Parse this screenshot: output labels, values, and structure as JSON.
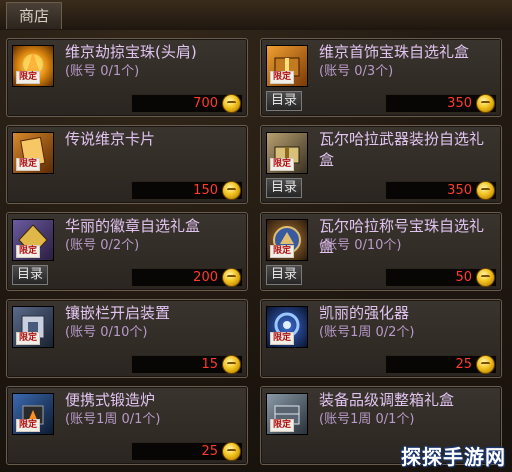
{
  "shop_tab": "商店",
  "badge_text": "限定",
  "dir_label": "目录",
  "currency": "coin-icon",
  "items": [
    {
      "name": "维京劫掠宝珠(头肩)",
      "limit": "(账号 0/1个)",
      "price": "700",
      "icon": "fire-orb-icon",
      "dir": false
    },
    {
      "name": "维京首饰宝珠自选礼盒",
      "limit": "(账号 0/3个)",
      "price": "350",
      "icon": "gift-box-icon",
      "dir": true
    },
    {
      "name": "传说维京卡片",
      "limit": "",
      "price": "150",
      "icon": "card-icon",
      "dir": false
    },
    {
      "name": "瓦尔哈拉武器装扮自选礼盒",
      "limit": "",
      "price": "350",
      "icon": "gift-box-icon",
      "dir": true
    },
    {
      "name": "华丽的徽章自选礼盒",
      "limit": "(账号 0/2个)",
      "price": "200",
      "icon": "emblem-icon",
      "dir": true
    },
    {
      "name": "瓦尔哈拉称号宝珠自选礼盒",
      "limit": "(账号 0/10个)",
      "price": "50",
      "icon": "title-orb-icon",
      "dir": true
    },
    {
      "name": "镶嵌栏开启装置",
      "limit": "(账号 0/10个)",
      "price": "15",
      "icon": "socket-icon",
      "dir": false
    },
    {
      "name": "凯丽的强化器",
      "limit": "(账号1周 0/2个)",
      "price": "25",
      "icon": "enhancer-icon",
      "dir": false
    },
    {
      "name": "便携式锻造炉",
      "limit": "(账号1周 0/1个)",
      "price": "25",
      "icon": "forge-icon",
      "dir": false
    },
    {
      "name": "装备品级调整箱礼盒",
      "limit": "(账号1周 0/1个)",
      "price": "",
      "icon": "equip-box-icon",
      "dir": false
    }
  ],
  "watermark": "探探手游网"
}
